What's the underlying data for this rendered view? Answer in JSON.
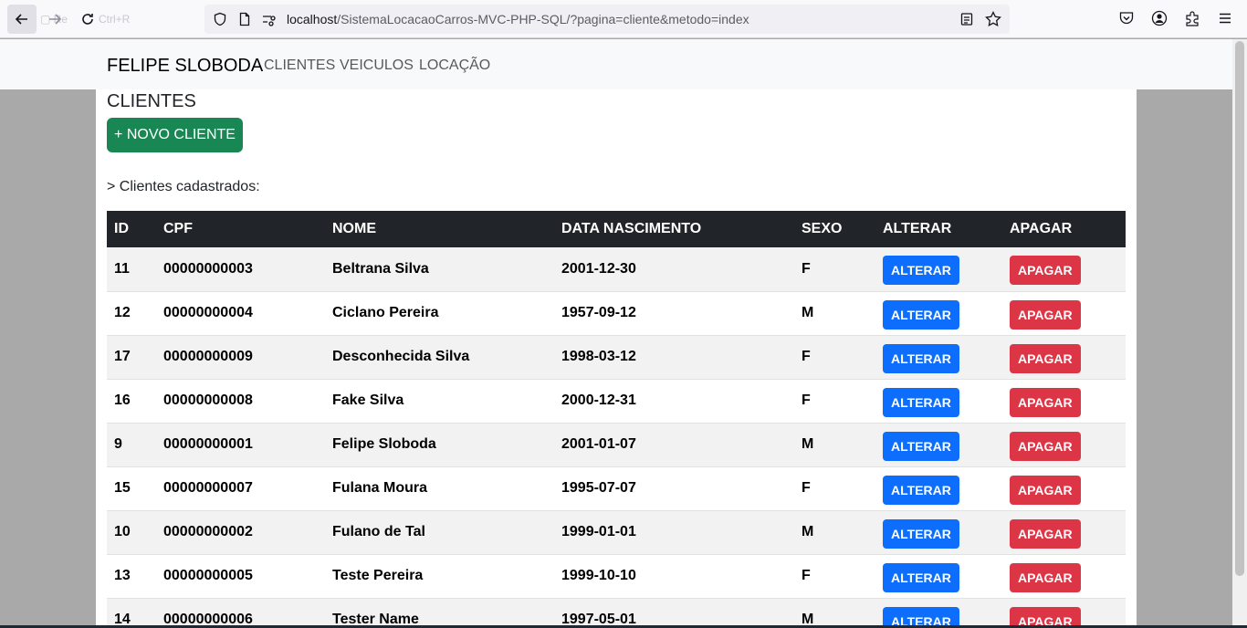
{
  "browser": {
    "url_host": "localhost",
    "url_path": "/SistemaLocacaoCarros-MVC-PHP-SQL/?pagina=cliente&metodo=index"
  },
  "navbar": {
    "brand": "FELIPE SLOBODA",
    "links": [
      "CLIENTES",
      "VEICULOS",
      "LOCAÇÃO"
    ]
  },
  "main": {
    "title": "CLIENTES",
    "new_button": "+ NOVO CLIENTE",
    "subtitle": "> Clientes cadastrados:",
    "columns": [
      "ID",
      "CPF",
      "NOME",
      "DATA NASCIMENTO",
      "SEXO",
      "ALTERAR",
      "APAGAR"
    ],
    "alter_label": "ALTERAR",
    "delete_label": "APAGAR",
    "rows": [
      {
        "id": "11",
        "cpf": "00000000003",
        "nome": "Beltrana Silva",
        "nascimento": "2001-12-30",
        "sexo": "F"
      },
      {
        "id": "12",
        "cpf": "00000000004",
        "nome": "Ciclano Pereira",
        "nascimento": "1957-09-12",
        "sexo": "M"
      },
      {
        "id": "17",
        "cpf": "00000000009",
        "nome": "Desconhecida Silva",
        "nascimento": "1998-03-12",
        "sexo": "F"
      },
      {
        "id": "16",
        "cpf": "00000000008",
        "nome": "Fake Silva",
        "nascimento": "2000-12-31",
        "sexo": "F"
      },
      {
        "id": "9",
        "cpf": "00000000001",
        "nome": "Felipe Sloboda",
        "nascimento": "2001-01-07",
        "sexo": "M"
      },
      {
        "id": "15",
        "cpf": "00000000007",
        "nome": "Fulana Moura",
        "nascimento": "1995-07-07",
        "sexo": "F"
      },
      {
        "id": "10",
        "cpf": "00000000002",
        "nome": "Fulano de Tal",
        "nascimento": "1999-01-01",
        "sexo": "M"
      },
      {
        "id": "13",
        "cpf": "00000000005",
        "nome": "Teste Pereira",
        "nascimento": "1999-10-10",
        "sexo": "F"
      },
      {
        "id": "14",
        "cpf": "00000000006",
        "nome": "Tester Name",
        "nascimento": "1997-05-01",
        "sexo": "M"
      }
    ]
  },
  "colors": {
    "success": "#198754",
    "primary": "#0d6efd",
    "danger": "#dc3545",
    "table_header": "#212529"
  }
}
